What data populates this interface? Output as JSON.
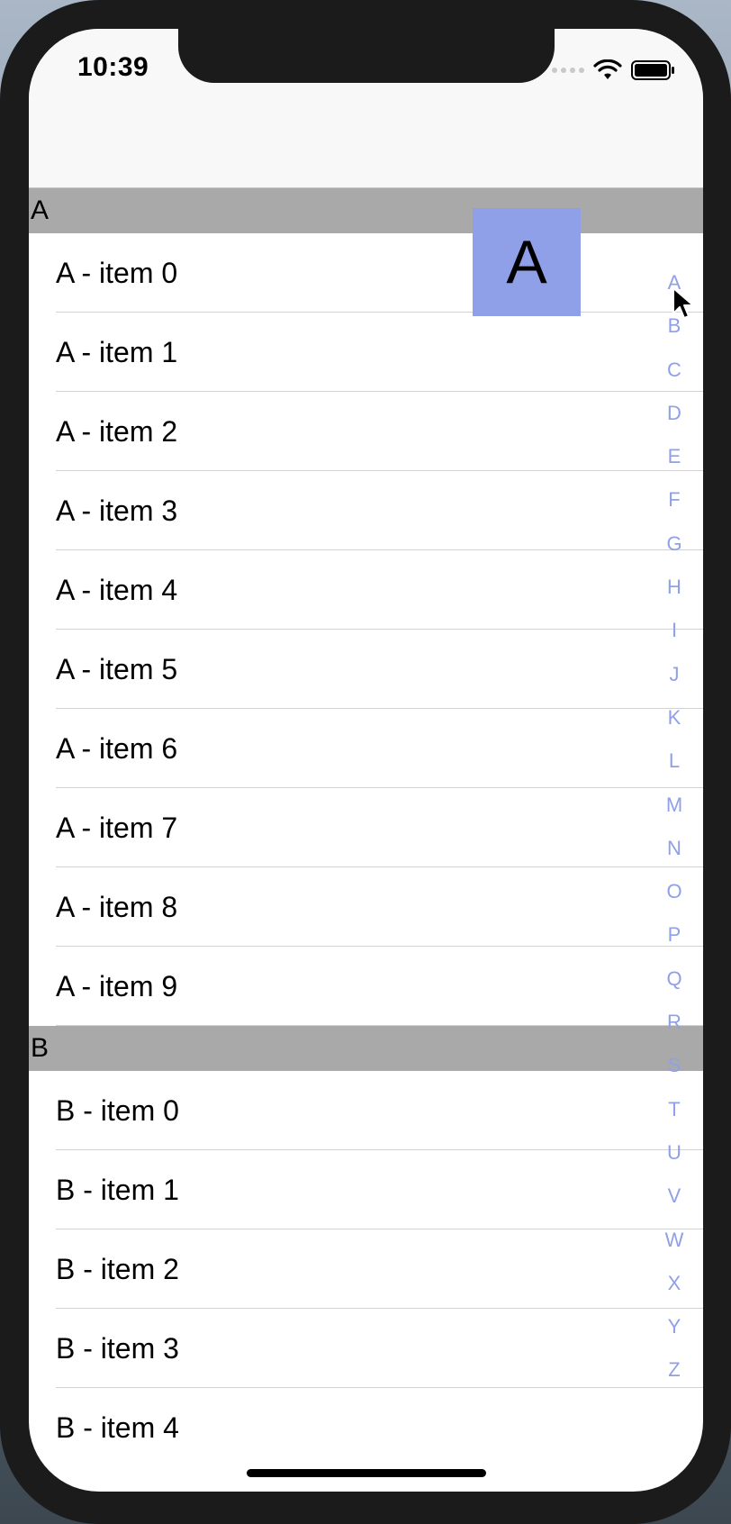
{
  "status_bar": {
    "time": "10:39",
    "icons": [
      "signal-icon",
      "wifi-icon",
      "battery-icon"
    ]
  },
  "sections": [
    {
      "header": "A",
      "items": [
        "A - item 0",
        "A - item 1",
        "A - item 2",
        "A - item 3",
        "A - item 4",
        "A - item 5",
        "A - item 6",
        "A - item 7",
        "A - item 8",
        "A - item 9"
      ]
    },
    {
      "header": "B",
      "items": [
        "B - item 0",
        "B - item 1",
        "B - item 2",
        "B - item 3",
        "B - item 4"
      ]
    }
  ],
  "index_letters": [
    "A",
    "B",
    "C",
    "D",
    "E",
    "F",
    "G",
    "H",
    "I",
    "J",
    "K",
    "L",
    "M",
    "N",
    "O",
    "P",
    "Q",
    "R",
    "S",
    "T",
    "U",
    "V",
    "W",
    "X",
    "Y",
    "Z"
  ],
  "overlay_letter": "A",
  "colors": {
    "section_header_bg": "#a9a9a9",
    "index_accent": "#8fa0e8"
  }
}
